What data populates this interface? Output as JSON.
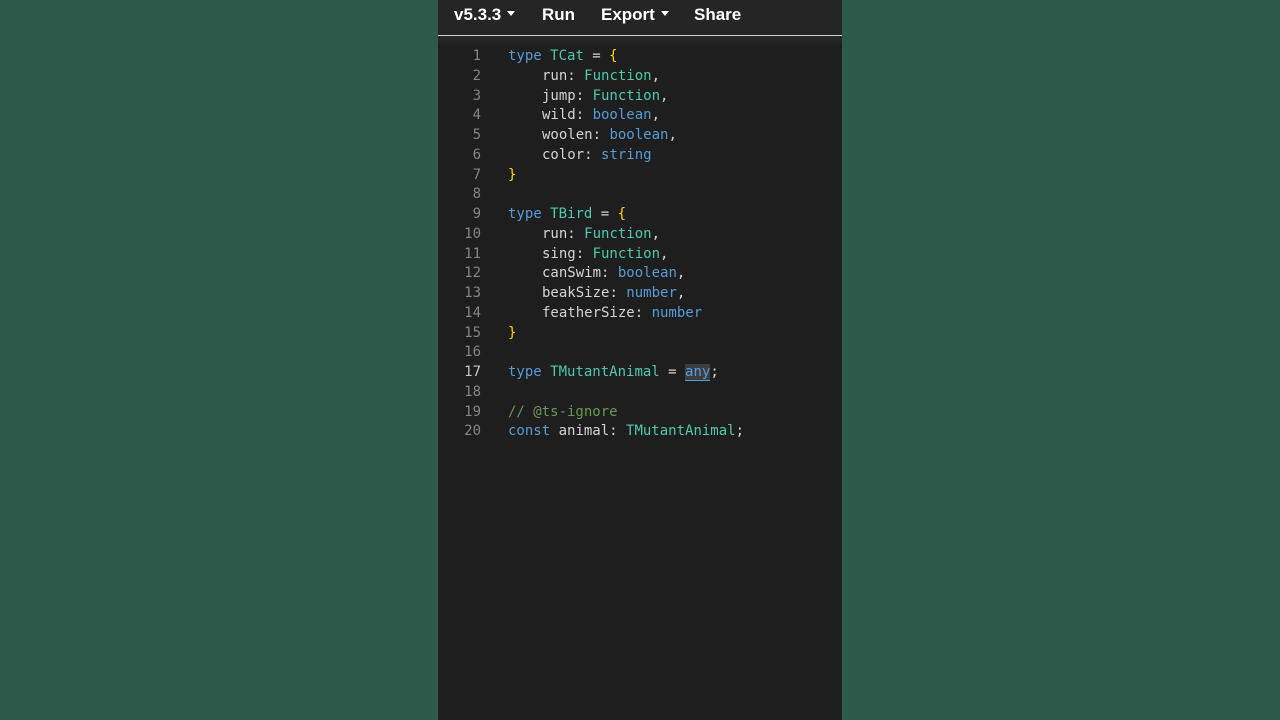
{
  "toolbar": {
    "version_label": "v5.3.3",
    "run_label": "Run",
    "export_label": "Export",
    "share_label": "Share"
  },
  "editor": {
    "active_line": 17,
    "lines": [
      {
        "n": "1",
        "tokens": [
          [
            "kw",
            "type"
          ],
          [
            "pn",
            " "
          ],
          [
            "ty",
            "TCat"
          ],
          [
            "pn",
            " = "
          ],
          [
            "br",
            "{"
          ]
        ]
      },
      {
        "n": "2",
        "indent": true,
        "tokens": [
          [
            "pr",
            "run"
          ],
          [
            "pn",
            ": "
          ],
          [
            "ty",
            "Function"
          ],
          [
            "pn",
            ","
          ]
        ]
      },
      {
        "n": "3",
        "indent": true,
        "tokens": [
          [
            "pr",
            "jump"
          ],
          [
            "pn",
            ": "
          ],
          [
            "ty",
            "Function"
          ],
          [
            "pn",
            ","
          ]
        ]
      },
      {
        "n": "4",
        "indent": true,
        "tokens": [
          [
            "pr",
            "wild"
          ],
          [
            "pn",
            ": "
          ],
          [
            "kw",
            "boolean"
          ],
          [
            "pn",
            ","
          ]
        ]
      },
      {
        "n": "5",
        "indent": true,
        "tokens": [
          [
            "pr",
            "woolen"
          ],
          [
            "pn",
            ": "
          ],
          [
            "kw",
            "boolean"
          ],
          [
            "pn",
            ","
          ]
        ]
      },
      {
        "n": "6",
        "indent": true,
        "tokens": [
          [
            "pr",
            "color"
          ],
          [
            "pn",
            ": "
          ],
          [
            "kw",
            "string"
          ]
        ]
      },
      {
        "n": "7",
        "tokens": [
          [
            "br",
            "}"
          ]
        ]
      },
      {
        "n": "8",
        "tokens": []
      },
      {
        "n": "9",
        "tokens": [
          [
            "kw",
            "type"
          ],
          [
            "pn",
            " "
          ],
          [
            "ty",
            "TBird"
          ],
          [
            "pn",
            " = "
          ],
          [
            "br",
            "{"
          ]
        ]
      },
      {
        "n": "10",
        "indent": true,
        "tokens": [
          [
            "pr",
            "run"
          ],
          [
            "pn",
            ": "
          ],
          [
            "ty",
            "Function"
          ],
          [
            "pn",
            ","
          ]
        ]
      },
      {
        "n": "11",
        "indent": true,
        "tokens": [
          [
            "pr",
            "sing"
          ],
          [
            "pn",
            ": "
          ],
          [
            "ty",
            "Function"
          ],
          [
            "pn",
            ","
          ]
        ]
      },
      {
        "n": "12",
        "indent": true,
        "tokens": [
          [
            "pr",
            "canSwim"
          ],
          [
            "pn",
            ": "
          ],
          [
            "kw",
            "boolean"
          ],
          [
            "pn",
            ","
          ]
        ]
      },
      {
        "n": "13",
        "indent": true,
        "tokens": [
          [
            "pr",
            "beakSize"
          ],
          [
            "pn",
            ": "
          ],
          [
            "kw",
            "number"
          ],
          [
            "pn",
            ","
          ]
        ]
      },
      {
        "n": "14",
        "indent": true,
        "tokens": [
          [
            "pr",
            "featherSize"
          ],
          [
            "pn",
            ": "
          ],
          [
            "kw",
            "number"
          ]
        ]
      },
      {
        "n": "15",
        "tokens": [
          [
            "br",
            "}"
          ]
        ]
      },
      {
        "n": "16",
        "tokens": []
      },
      {
        "n": "17",
        "tokens": [
          [
            "kw",
            "type"
          ],
          [
            "pn",
            " "
          ],
          [
            "ty",
            "TMutantAnimal"
          ],
          [
            "pn",
            " = "
          ],
          [
            "hl",
            "any"
          ],
          [
            "pn",
            ";"
          ]
        ]
      },
      {
        "n": "18",
        "tokens": []
      },
      {
        "n": "19",
        "tokens": [
          [
            "cm",
            "// @ts-ignore"
          ]
        ]
      },
      {
        "n": "20",
        "tokens": [
          [
            "kw",
            "const"
          ],
          [
            "pn",
            " animal: "
          ],
          [
            "ty",
            "TMutantAnimal"
          ],
          [
            "pn",
            ";"
          ]
        ]
      }
    ]
  },
  "colors": {
    "background": "#2d5a4a",
    "editor_bg": "#1e1e1e",
    "keyword": "#569cd6",
    "type": "#4ec9b0",
    "bracket": "#ffd700",
    "comment": "#6a9955"
  }
}
